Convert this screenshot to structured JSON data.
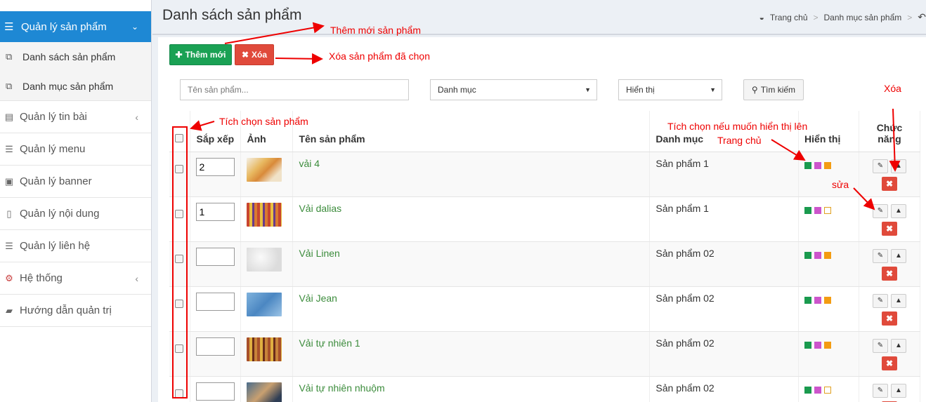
{
  "sidebar": {
    "active": "Quản lý sản phẩm",
    "subitems": [
      "Danh sách sản phẩm",
      "Danh mục sản phẩm"
    ],
    "items": [
      "Quản lý tin bài",
      "Quản lý menu",
      "Quản lý banner",
      "Quản lý nội dung",
      "Quản lý liên hệ",
      "Hệ thống",
      "Hướng dẫn quản trị"
    ]
  },
  "header": {
    "title": "Danh sách sản phẩm",
    "breadcrumb": [
      "Trang chủ",
      "Danh mục sản phẩm"
    ]
  },
  "toolbar": {
    "add_label": "Thêm mới",
    "delete_label": "Xóa"
  },
  "filters": {
    "name_placeholder": "Tên sản phẩm...",
    "category": "Danh mục",
    "display": "Hiển thị",
    "search_label": "Tìm kiếm"
  },
  "table": {
    "headers": [
      "Sắp xếp",
      "Ảnh",
      "Tên sản phẩm",
      "Danh mục",
      "Hiển thị",
      "Chức năng"
    ],
    "rows": [
      {
        "order": "2",
        "name": "vải 4",
        "category": "Sản phẩm 1",
        "flags": [
          "green",
          "purple",
          "orange"
        ]
      },
      {
        "order": "1",
        "name": "Vải dalias",
        "category": "Sản phẩm 1",
        "flags": [
          "green",
          "purple",
          "empty"
        ]
      },
      {
        "order": "",
        "name": "Vải Linen",
        "category": "Sản phẩm 02",
        "flags": [
          "green",
          "purple",
          "orange"
        ]
      },
      {
        "order": "",
        "name": "Vải Jean",
        "category": "Sản phẩm 02",
        "flags": [
          "green",
          "purple",
          "orange"
        ]
      },
      {
        "order": "",
        "name": "Vải tự nhiên 1",
        "category": "Sản phẩm 02",
        "flags": [
          "green",
          "purple",
          "orange"
        ]
      },
      {
        "order": "",
        "name": "Vải tự nhiên nhuộm",
        "category": "Sản phẩm 02",
        "flags": [
          "green",
          "purple",
          "empty"
        ]
      }
    ]
  },
  "annotations": {
    "add": "Thêm mới sản phẩm",
    "delete_selected": "Xóa sản phẩm đã chọn",
    "select": "Tích chọn sản phẩm",
    "home_line1": "Tích chọn nếu muốn hiển thị lên",
    "home_line2": "Trang chủ",
    "delete": "Xóa",
    "edit": "sửa"
  }
}
